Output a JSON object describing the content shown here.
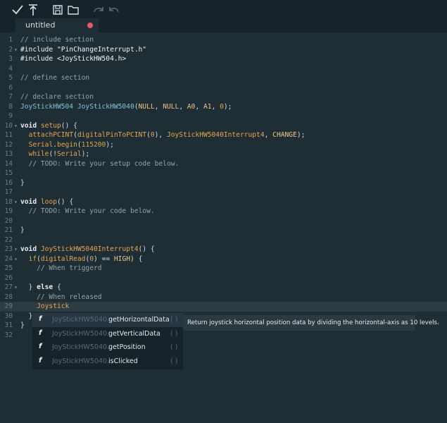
{
  "toolbar": {
    "icons": [
      "verify-check-icon",
      "upload-arrow-icon",
      "save-icon",
      "open-folder-icon",
      "redo-icon",
      "undo-icon"
    ]
  },
  "tab": {
    "label": "untitled",
    "unsaved_color": "#e35a6c"
  },
  "editor": {
    "lines": [
      {
        "n": "1",
        "fold": "",
        "html": "<span class=\"cm\">// include section</span>"
      },
      {
        "n": "2",
        "fold": "▾",
        "html": "<span class=\"inc\">#include \"PinChangeInterrupt.h\"</span>"
      },
      {
        "n": "3",
        "fold": "",
        "html": "<span class=\"inc\">#include &lt;JoyStickHW504.h&gt;</span>"
      },
      {
        "n": "4",
        "fold": "",
        "html": ""
      },
      {
        "n": "5",
        "fold": "",
        "html": "<span class=\"cm\">// define section</span>"
      },
      {
        "n": "6",
        "fold": "",
        "html": ""
      },
      {
        "n": "7",
        "fold": "",
        "html": "<span class=\"cm\">// declare section</span>"
      },
      {
        "n": "8",
        "fold": "",
        "html": "<span class=\"ty\">JoyStickHW504</span> <span class=\"ty\">JoyStickHW5040</span>(<span class=\"cst\">NULL</span>, <span class=\"cst\">NULL</span>, <span class=\"cst\">A0</span>, <span class=\"cst\">A1</span>, <span class=\"num\">0</span>);"
      },
      {
        "n": "9",
        "fold": "",
        "html": ""
      },
      {
        "n": "10",
        "fold": "▾",
        "html": "<span class=\"kw\">void</span> <span class=\"fn\">setup</span>() {"
      },
      {
        "n": "11",
        "fold": "",
        "html": "  <span class=\"fn\">attachPCINT</span>(<span class=\"fn\">digitalPinToPCINT</span>(<span class=\"num\">0</span>), <span class=\"fn\">JoyStickHW5040Interrupt4</span>, <span class=\"cst\">CHANGE</span>);"
      },
      {
        "n": "12",
        "fold": "",
        "html": "  <span class=\"fn\">Serial</span>.<span class=\"fn\">begin</span>(<span class=\"num\">115200</span>);"
      },
      {
        "n": "13",
        "fold": "",
        "html": "  <span class=\"fn\">while</span>(!<span class=\"fn\">Serial</span>);"
      },
      {
        "n": "14",
        "fold": "",
        "html": "  <span class=\"cm\">// TODO: Write your setup code below.</span>"
      },
      {
        "n": "15",
        "fold": "",
        "html": ""
      },
      {
        "n": "16",
        "fold": "",
        "html": "}"
      },
      {
        "n": "17",
        "fold": "",
        "html": ""
      },
      {
        "n": "18",
        "fold": "▾",
        "html": "<span class=\"kw\">void</span> <span class=\"fn\">loop</span>() {"
      },
      {
        "n": "19",
        "fold": "",
        "html": "  <span class=\"cm\">// TODO: Write your code below.</span>"
      },
      {
        "n": "20",
        "fold": "",
        "html": ""
      },
      {
        "n": "21",
        "fold": "",
        "html": "}"
      },
      {
        "n": "22",
        "fold": "",
        "html": ""
      },
      {
        "n": "23",
        "fold": "▾",
        "html": "<span class=\"kw\">void</span> <span class=\"fn\">JoyStickHW5040Interrupt4</span>() {"
      },
      {
        "n": "24",
        "fold": "▾",
        "html": "  <span class=\"fn\">if</span>(<span class=\"fn\">digitalRead</span>(<span class=\"num\">0</span>) == <span class=\"cst\">HIGH</span>) {"
      },
      {
        "n": "25",
        "fold": "",
        "html": "    <span class=\"cm\">// When triggerd</span>"
      },
      {
        "n": "26",
        "fold": "",
        "html": ""
      },
      {
        "n": "27",
        "fold": "▾",
        "html": "  } <span class=\"kw\">else</span> {"
      },
      {
        "n": "28",
        "fold": "",
        "html": "    <span class=\"cm\">// When released</span>"
      },
      {
        "n": "29",
        "fold": "",
        "html": "    <span class=\"hl-word\">Joystick</span>",
        "active": true
      },
      {
        "n": "30",
        "fold": "",
        "html": "  }"
      },
      {
        "n": "31",
        "fold": "",
        "html": "}"
      },
      {
        "n": "32",
        "fold": "",
        "html": ""
      }
    ]
  },
  "autocomplete": {
    "kind_glyph": "f",
    "items": [
      {
        "context": "JoyStickHW5040.",
        "name": "getHorizontalData",
        "params": "( )",
        "selected": true
      },
      {
        "context": "JoyStickHW5040.",
        "name": "getVerticalData",
        "params": "( )",
        "selected": false
      },
      {
        "context": "JoyStickHW5040.",
        "name": "getPosition",
        "params": "( )",
        "selected": false
      },
      {
        "context": "JoyStickHW5040.",
        "name": "isClicked",
        "params": "( )",
        "selected": false
      }
    ],
    "doc": "Return joystick horizontal position data by dividing the horizontal-axis as 10 levels."
  }
}
